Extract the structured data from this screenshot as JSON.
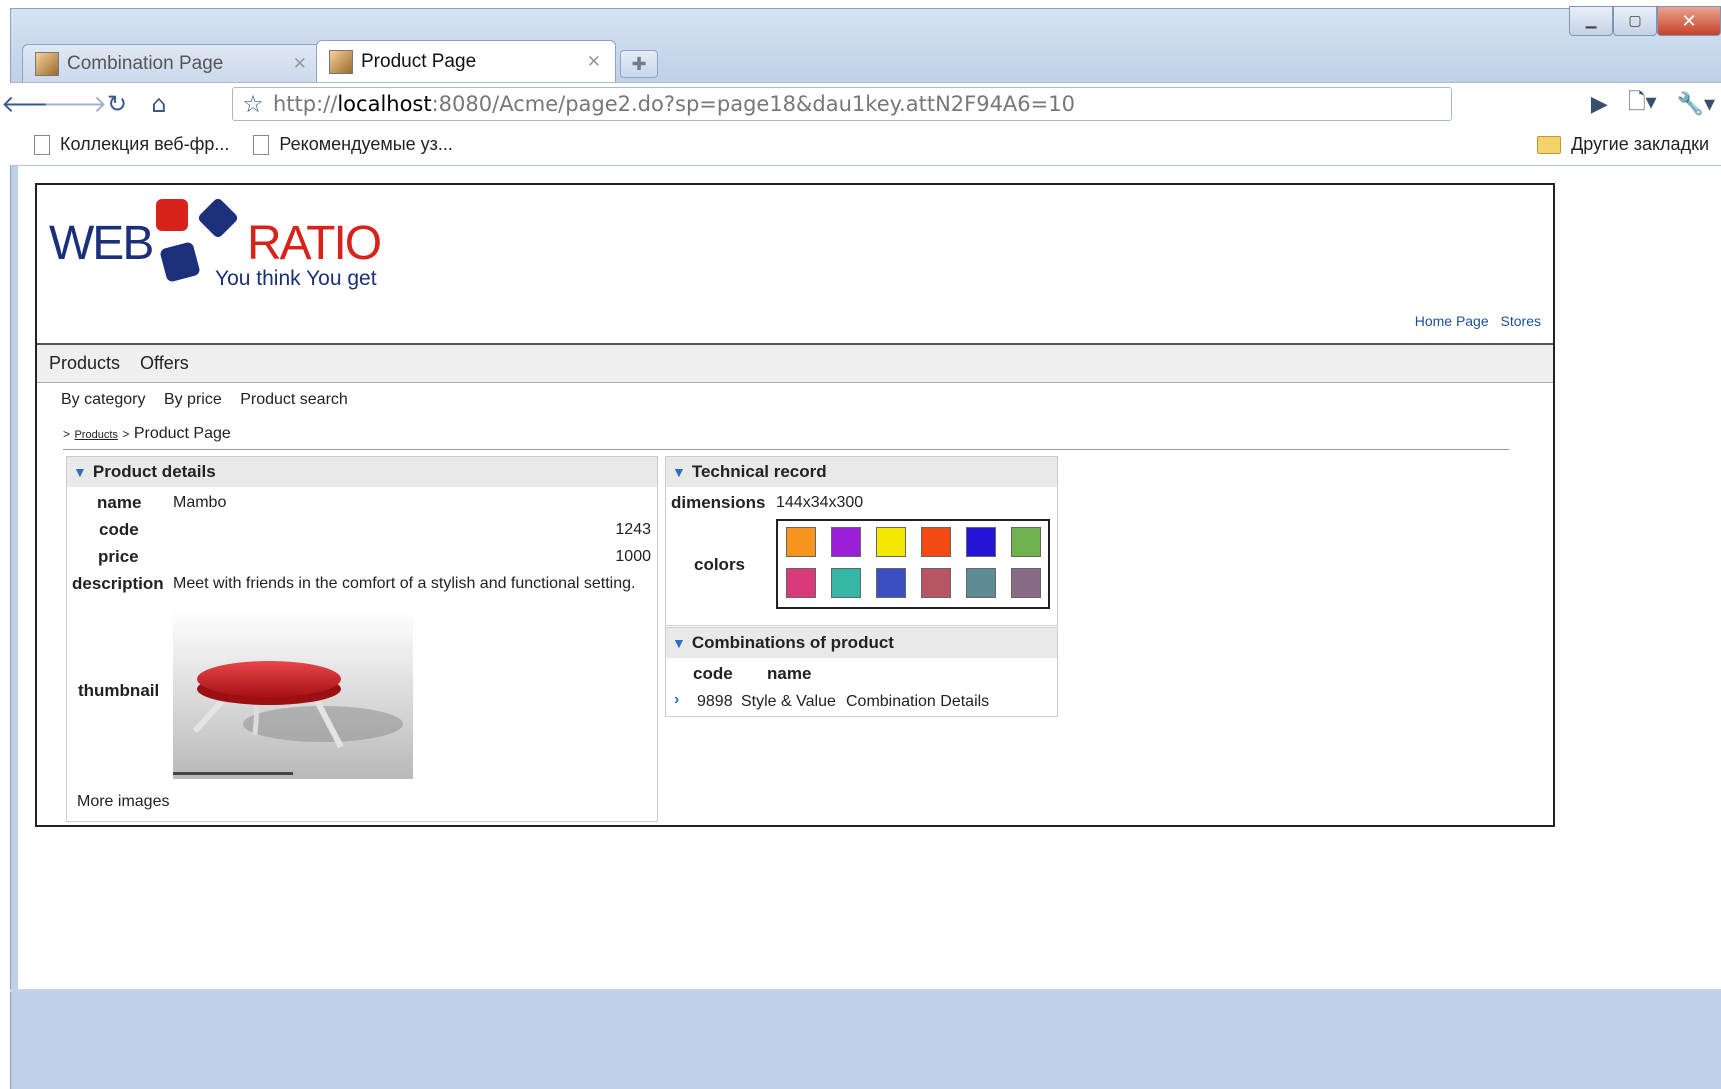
{
  "browser": {
    "tabs": [
      {
        "label": "Combination Page",
        "active": false
      },
      {
        "label": "Product Page",
        "active": true
      }
    ],
    "url_prefix": "http://",
    "url_host": "localhost",
    "url_rest": ":8080/Acme/page2.do?sp=page18&dau1key.attN2F94A6=10",
    "bookmarks": [
      "Коллекция веб-фр...",
      "Рекомендуемые уз..."
    ],
    "other_bookmarks": "Другие закладки"
  },
  "site": {
    "logo_web": "WEB",
    "logo_ratio": "RATIO",
    "logo_tagline": "You think You get",
    "top_links": [
      "Home Page",
      "Stores"
    ],
    "main_nav": [
      "Products",
      "Offers"
    ],
    "sub_nav": [
      "By category",
      "By price",
      "Product search"
    ],
    "breadcrumb": {
      "prefix": ">",
      "link": "Products",
      "sep": ">",
      "current": "Product Page"
    }
  },
  "product_details": {
    "title": "Product details",
    "name_label": "name",
    "name": "Mambo",
    "code_label": "code",
    "code": "1243",
    "price_label": "price",
    "price": "1000",
    "description_label": "description",
    "description": "Meet with friends in the comfort of a stylish and functional setting.",
    "thumbnail_label": "thumbnail",
    "more_images": "More images"
  },
  "technical_record": {
    "title": "Technical record",
    "dimensions_label": "dimensions",
    "dimensions": "144x34x300",
    "colors_label": "colors",
    "colors": [
      "#f7941d",
      "#9a1fd6",
      "#f5e800",
      "#f24a12",
      "#2213d6",
      "#6fb24f",
      "#d83a7a",
      "#36b7a6",
      "#3c4fc2",
      "#b85565",
      "#5f8c94",
      "#8a6b86"
    ]
  },
  "combinations": {
    "title": "Combinations of product",
    "headers": [
      "code",
      "name"
    ],
    "rows": [
      {
        "code": "9898",
        "name": "Style & Value",
        "action": "Combination Details"
      }
    ]
  }
}
